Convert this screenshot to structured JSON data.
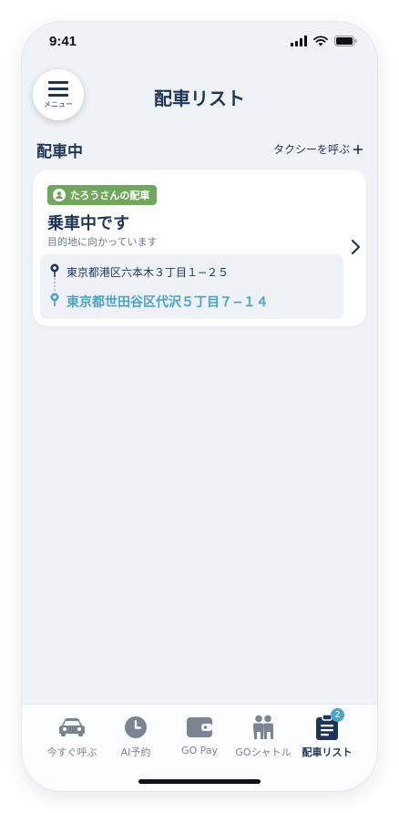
{
  "status_bar": {
    "time": "9:41"
  },
  "header": {
    "menu_label": "メニュー",
    "title": "配車リスト"
  },
  "section": {
    "title": "配車中",
    "call_taxi_label": "タクシーを呼ぶ"
  },
  "ride_card": {
    "badge": "たろうさんの配車",
    "status": "乗車中です",
    "substatus": "目的地に向かっています",
    "pickup_address": "東京都港区六本木３丁目１−２５",
    "destination_address": "東京都世田谷区代沢５丁目７−１４"
  },
  "tab_bar": {
    "tabs": [
      {
        "label": "今すぐ呼ぶ",
        "icon": "car-icon"
      },
      {
        "label": "AI予約",
        "icon": "clock-icon"
      },
      {
        "label": "GO Pay",
        "icon": "wallet-icon"
      },
      {
        "label": "GOシャトル",
        "icon": "people-icon"
      },
      {
        "label": "配車リスト",
        "icon": "clipboard-icon",
        "badge": "2",
        "active": true
      }
    ]
  },
  "colors": {
    "accent": "#4aa3c8",
    "navy": "#1f3556",
    "badge_green": "#6fa85a",
    "background": "#eff3f7"
  }
}
